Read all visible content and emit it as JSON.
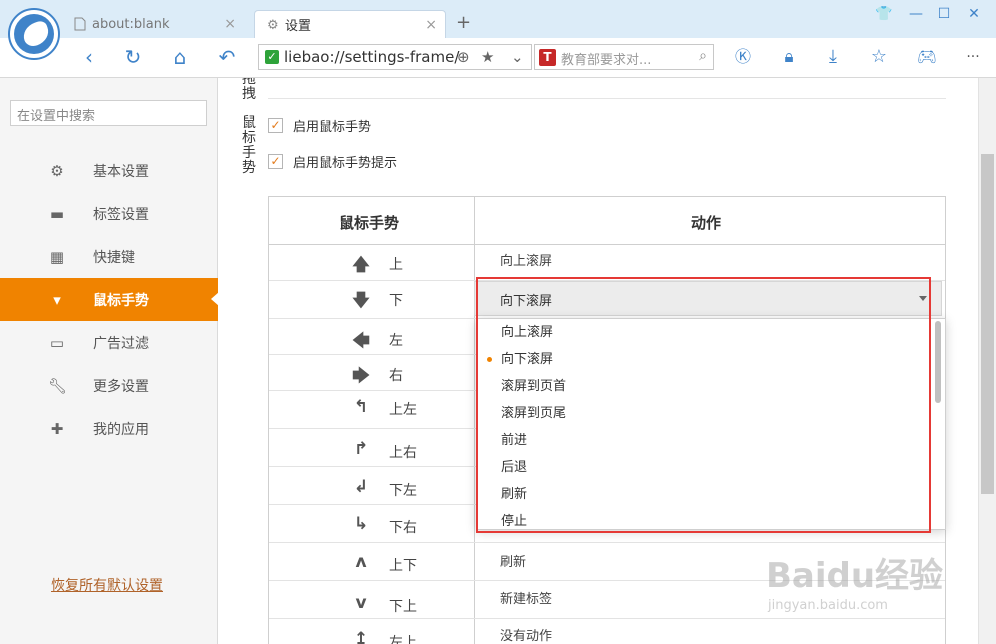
{
  "tabs": [
    {
      "title": "about:blank",
      "icon": "page-icon"
    },
    {
      "title": "设置",
      "icon": "gear-icon"
    }
  ],
  "address": {
    "url": "liebao://settings-frame/"
  },
  "search": {
    "placeholder": "教育部要求对..."
  },
  "sidebar": {
    "search_placeholder": "在设置中搜索",
    "items": [
      {
        "label": "基本设置",
        "icon": "gear-icon"
      },
      {
        "label": "标签设置",
        "icon": "tab-icon"
      },
      {
        "label": "快捷键",
        "icon": "shortcut-icon"
      },
      {
        "label": "鼠标手势",
        "icon": "mouse-icon"
      },
      {
        "label": "广告过滤",
        "icon": "window-icon"
      },
      {
        "label": "更多设置",
        "icon": "wrench-icon"
      },
      {
        "label": "我的应用",
        "icon": "puzzle-icon"
      }
    ],
    "active_index": 3,
    "restore_label": "恢复所有默认设置"
  },
  "section": {
    "drag_label": "拖\n拽",
    "gesture_label": "鼠\n标\n手\n势",
    "enable_gesture": "启用鼠标手势",
    "enable_hint": "启用鼠标手势提示"
  },
  "table": {
    "col_gesture": "鼠标手势",
    "col_action": "动作",
    "rows": [
      {
        "arrow": "🡅",
        "name": "上",
        "action": "向上滚屏"
      },
      {
        "arrow": "🡇",
        "name": "下",
        "action": "向下滚屏"
      },
      {
        "arrow": "🡄",
        "name": "左",
        "action": ""
      },
      {
        "arrow": "🡆",
        "name": "右",
        "action": ""
      },
      {
        "arrow": "↰",
        "name": "上左",
        "action": ""
      },
      {
        "arrow": "↱",
        "name": "上右",
        "action": ""
      },
      {
        "arrow": "↲",
        "name": "下左",
        "action": ""
      },
      {
        "arrow": "↳",
        "name": "下右",
        "action": ""
      },
      {
        "arrow": "ʌ",
        "name": "上下",
        "action": "刷新"
      },
      {
        "arrow": "v",
        "name": "下上",
        "action": "新建标签"
      },
      {
        "arrow": "↥",
        "name": "左上",
        "action": "没有动作"
      }
    ]
  },
  "dropdown": {
    "selected": "向下滚屏",
    "options": [
      "向上滚屏",
      "向下滚屏",
      "滚屏到页首",
      "滚屏到页尾",
      "前进",
      "后退",
      "刷新",
      "停止"
    ],
    "selected_index": 1
  },
  "watermark": {
    "brand": "Baidu经验",
    "url": "jingyan.baidu.com"
  },
  "colors": {
    "accent": "#f08300",
    "link": "#3f83c9",
    "highlight": "#e53935"
  }
}
